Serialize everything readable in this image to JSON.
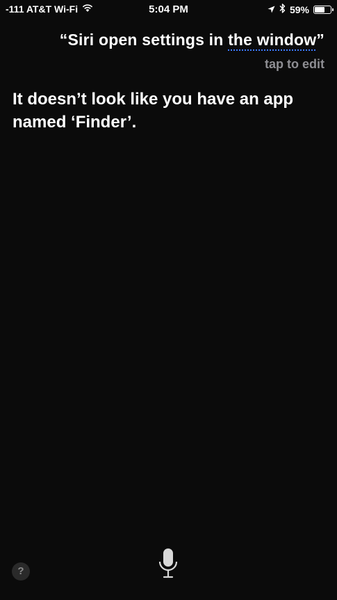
{
  "status_bar": {
    "carrier": "-111 AT&T Wi-Fi",
    "time": "5:04 PM",
    "battery_percent": "59%",
    "battery_level": 0.59,
    "icons": [
      "wifi-icon",
      "location-arrow-icon",
      "bluetooth-icon",
      "battery-icon"
    ]
  },
  "siri": {
    "query_prefix": "“Siri open settings in ",
    "query_underlined": "the window",
    "query_suffix": "”",
    "tap_to_edit": "tap to edit",
    "response": "It doesn’t look like you have an app named ‘Finder’."
  },
  "controls": {
    "help_label": "?",
    "mic_icon": "microphone-icon"
  },
  "colors": {
    "background": "#0b0b0b",
    "text": "#ffffff",
    "secondary_text": "#8e8e93",
    "underline_accent": "#3d7dff"
  }
}
